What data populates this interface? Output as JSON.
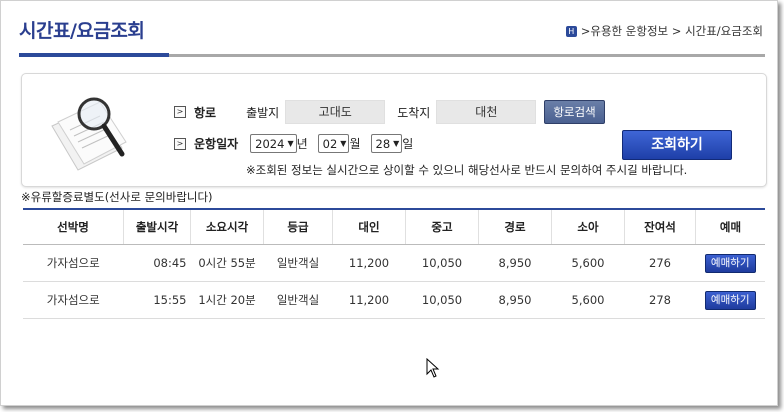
{
  "header": {
    "title": "시간표/요금조회",
    "breadcrumb": ">유용한 운항정보 > 시간표/요금조회"
  },
  "search": {
    "route_label": "항로",
    "departure_label": "출발지",
    "departure_value": "고대도",
    "arrival_label": "도착지",
    "arrival_value": "대천",
    "route_search_button": "항로검색",
    "date_label": "운항일자",
    "year": "2024",
    "year_unit": "년",
    "month": "02",
    "month_unit": "월",
    "day": "28",
    "day_unit": "일",
    "submit_button": "조회하기",
    "notice": "※조회된 정보는 실시간으로 상이할 수 있으니 해당선사로 반드시 문의하여 주시길 바랍니다."
  },
  "route_note": "※유류할증료별도(선사로 문의바랍니다)",
  "table": {
    "headers": [
      "선박명",
      "출발시각",
      "소요시각",
      "등급",
      "대인",
      "중고",
      "경로",
      "소아",
      "잔여석",
      "예매"
    ],
    "rows": [
      [
        "가자섬으로",
        "08:45",
        "0시간 55분",
        "일반객실",
        "11,200",
        "10,050",
        "8,950",
        "5,600",
        "276",
        "예매하기"
      ],
      [
        "가자섬으로",
        "15:55",
        "1시간 20분",
        "일반객실",
        "11,200",
        "10,050",
        "8,950",
        "5,600",
        "278",
        "예매하기"
      ]
    ]
  }
}
